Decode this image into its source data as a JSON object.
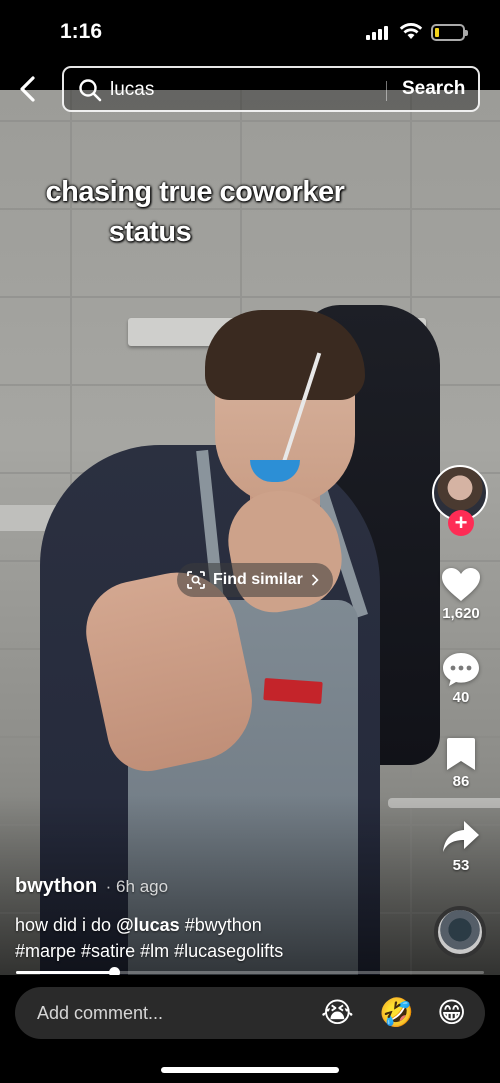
{
  "status_bar": {
    "time": "1:16",
    "battery_level": 0.15
  },
  "search": {
    "query": "lucas",
    "button_label": "Search"
  },
  "video": {
    "overlay_text_line1": "chasing true coworker",
    "overlay_text_line2": "status",
    "find_similar_label": "Find similar",
    "progress": 0.21
  },
  "actions": {
    "likes": "1,620",
    "comments": "40",
    "bookmarks": "86",
    "shares": "53"
  },
  "post": {
    "username": "bwython",
    "posted": "· 6h ago",
    "desc_prefix": "how did i do ",
    "mention": "@lucas",
    "tag1": "#bwython",
    "tag2": "#marpe",
    "tag3": "#satire",
    "tag4": "#lm",
    "tag5": "#lucasegolifts"
  },
  "comment_bar": {
    "placeholder": "Add comment...",
    "emojis": [
      "😭",
      "🤣",
      "😁"
    ]
  },
  "colors": {
    "follow": "#fe2c55",
    "battery": "#f2d21b"
  }
}
